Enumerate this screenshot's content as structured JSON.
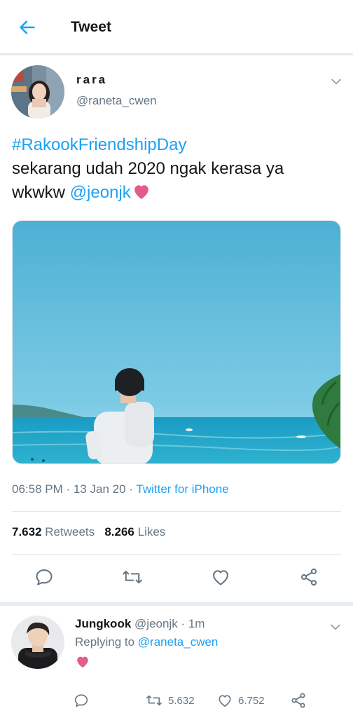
{
  "header": {
    "title": "Tweet",
    "back_icon": "arrow-left-icon",
    "accent_color": "#1da1f2"
  },
  "tweet": {
    "author": {
      "display_name": "rara",
      "handle": "@raneta_cwen"
    },
    "text": {
      "hashtag": "#RakookFriendshipDay",
      "body": "sekarang udah 2020 ngak kerasa ya wkwkw ",
      "mention": "@jeonjk",
      "emoji": "heart-emoji"
    },
    "meta": {
      "time": "06:58 PM",
      "separator": " · ",
      "date": "13 Jan 20",
      "source_separator": " · ",
      "source": "Twitter for iPhone"
    },
    "stats": {
      "retweets_count": "7.632",
      "retweets_label": "Retweets",
      "likes_count": "8.266",
      "likes_label": "Likes"
    },
    "actions": [
      "reply-icon",
      "retweet-icon",
      "like-icon",
      "share-icon"
    ]
  },
  "reply": {
    "author": {
      "display_name": "Jungkook",
      "handle": "@jeonjk",
      "dot": " · ",
      "time": "1m"
    },
    "replying_prefix": "Replying to ",
    "replying_to": "@raneta_cwen",
    "emoji": "heart-emoji",
    "retweets": "5.632",
    "likes": "6.752"
  }
}
